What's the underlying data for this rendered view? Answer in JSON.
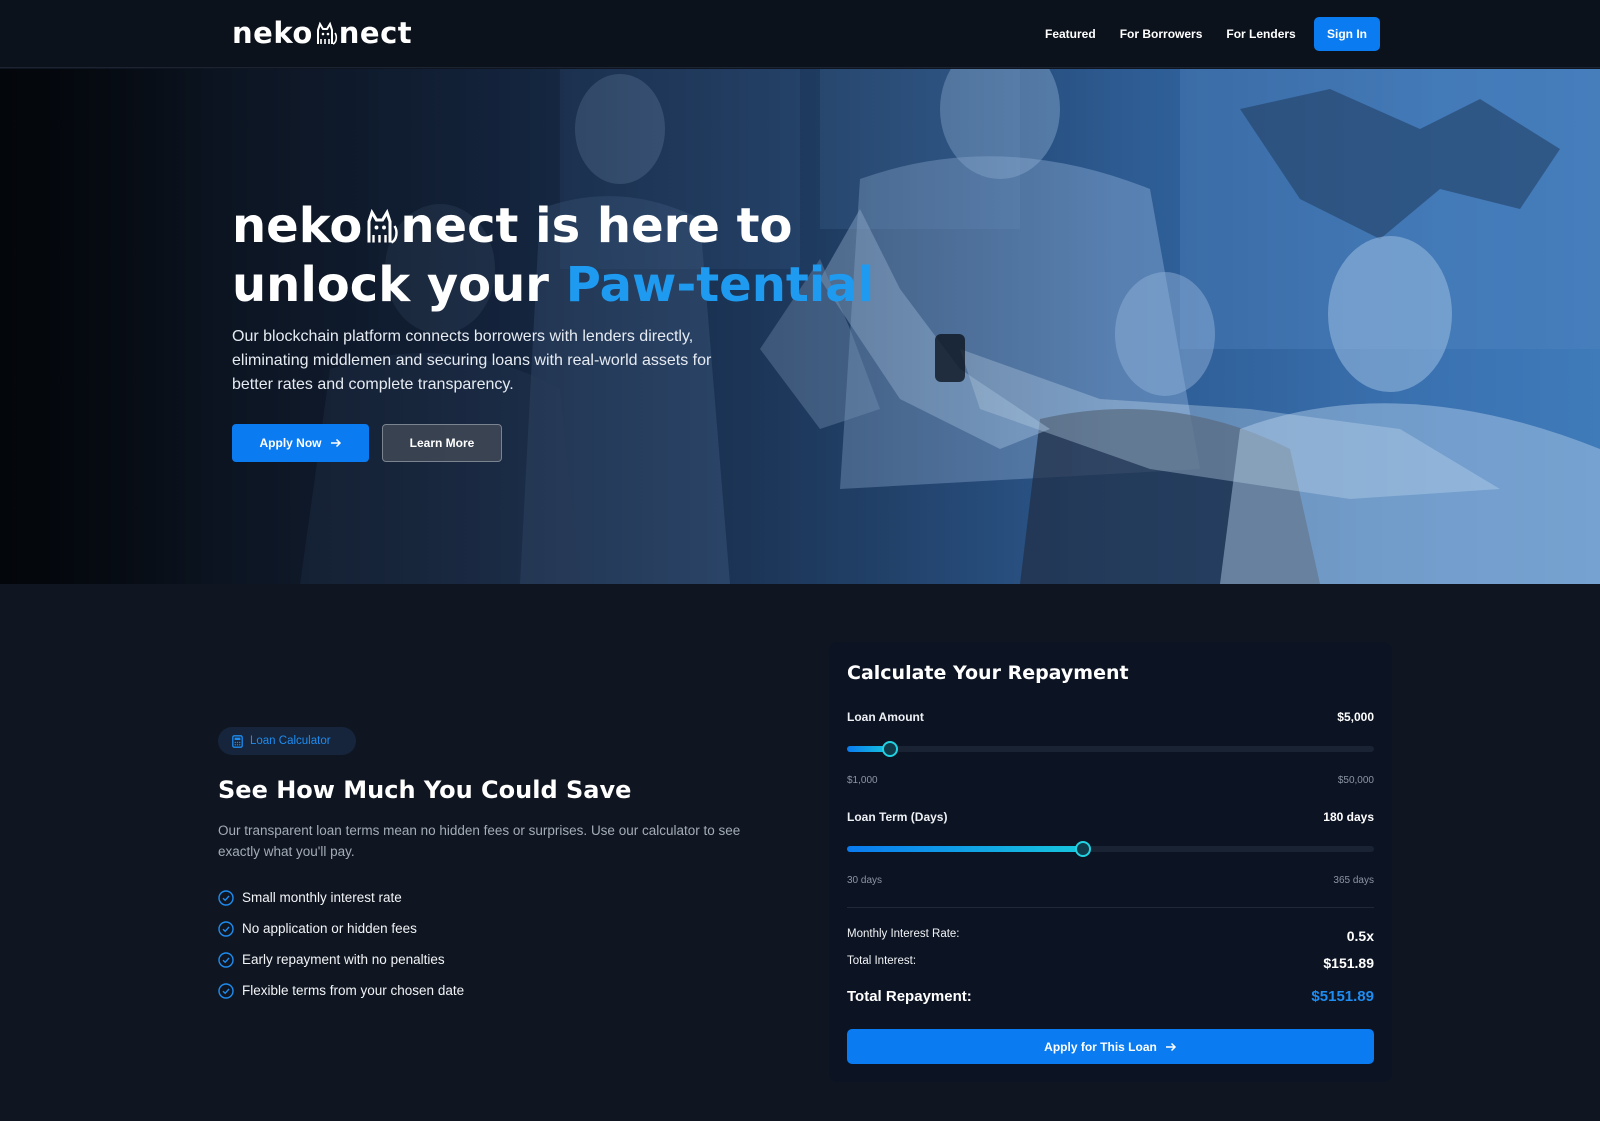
{
  "nav": {
    "logo_left": "neko",
    "logo_right": "nect",
    "links": [
      "Featured",
      "For Borrowers",
      "For Lenders"
    ],
    "signin": "Sign In"
  },
  "hero": {
    "title_part1": "neko",
    "title_part2": "nect is here to",
    "title_line2": "unlock your ",
    "title_accent": "Paw-tential",
    "description": "Our blockchain platform connects borrowers with lenders directly, eliminating middlemen and securing loans with real-world assets for better rates and complete transparency.",
    "apply_label": "Apply Now",
    "learn_label": "Learn More"
  },
  "calc_info": {
    "badge": "Loan Calculator",
    "title": "See How Much You Could Save",
    "description": "Our transparent loan terms mean no hidden fees or surprises. Use our calculator to see exactly what you'll pay.",
    "features": [
      "Small monthly interest rate",
      "No application or hidden fees",
      "Early repayment with no penalties",
      "Flexible terms from your chosen date"
    ]
  },
  "calculator": {
    "title": "Calculate Your Repayment",
    "amount_label": "Loan Amount",
    "amount_value": "$5,000",
    "amount_min": "$1,000",
    "amount_max": "$50,000",
    "amount_fraction": 0.082,
    "term_label": "Loan Term (Days)",
    "term_value": "180 days",
    "term_min": "30 days",
    "term_max": "365 days",
    "term_fraction": 0.448,
    "rate_label": "Monthly Interest Rate:",
    "rate_value": "0.5x",
    "interest_label": "Total Interest:",
    "interest_value": "$151.89",
    "total_label": "Total Repayment:",
    "total_value": "$5151.89",
    "apply_label": "Apply for This Loan"
  },
  "colors": {
    "accent": "#0a7bf0",
    "accent_text": "#1e8cf0",
    "slider_end": "#17c6dc",
    "background": "#0f1621"
  }
}
